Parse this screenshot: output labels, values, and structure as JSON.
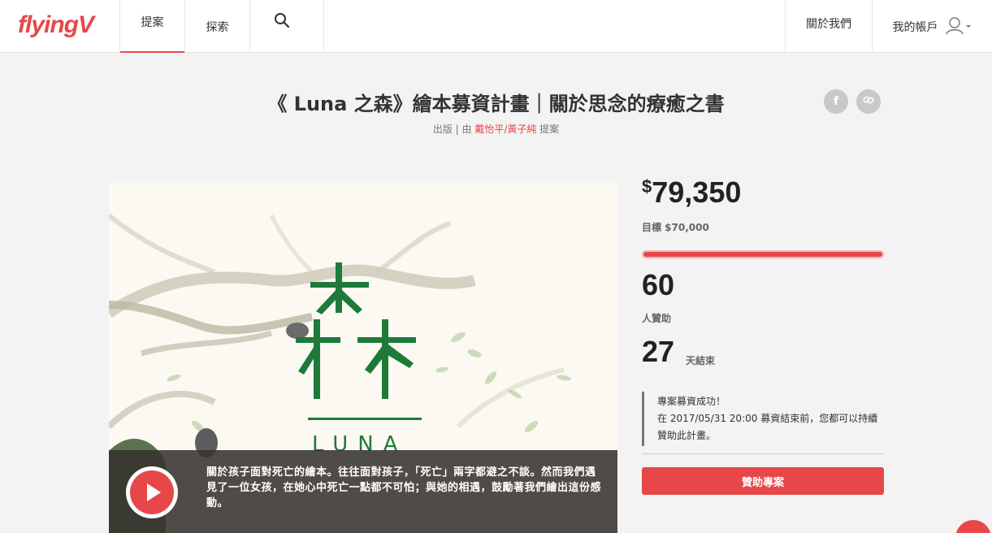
{
  "header": {
    "logo": "flyingV",
    "nav_propose": "提案",
    "nav_explore": "探索",
    "nav_about": "關於我們",
    "nav_account": "我的帳戶"
  },
  "project": {
    "title": "《 Luna 之森》繪本募資計畫｜關於思念的療癒之書",
    "category": "出版 | 由 ",
    "author": "戴怡平/黃子純",
    "proposed": " 提案"
  },
  "video": {
    "caption": "關於孩子面對死亡的繪本。往往面對孩子，「死亡」兩字都避之不談。然而我們遇見了一位女孩，在她心中死亡一點都不可怕；與她的相遇，鼓勵著我們繪出這份感動。"
  },
  "stats": {
    "currency_symbol": "$",
    "amount": "79,350",
    "goal": "目標 $70,000",
    "progress_fraction": 1.0,
    "backers": "60",
    "backers_label": "人贊助",
    "days": "27",
    "days_label": "天結束",
    "notice_line1": "專案募資成功！",
    "notice_line2": "在 2017/05/31 20:00 募資結束前，您都可以持續贊助此計畫。",
    "back_button": "贊助專案"
  },
  "colors": {
    "brand": "#e8474a",
    "forest_green": "#1e7a3a"
  },
  "icons": [
    "search-icon",
    "user-icon",
    "chevron-down-icon",
    "facebook-icon",
    "link-icon",
    "play-icon"
  ]
}
